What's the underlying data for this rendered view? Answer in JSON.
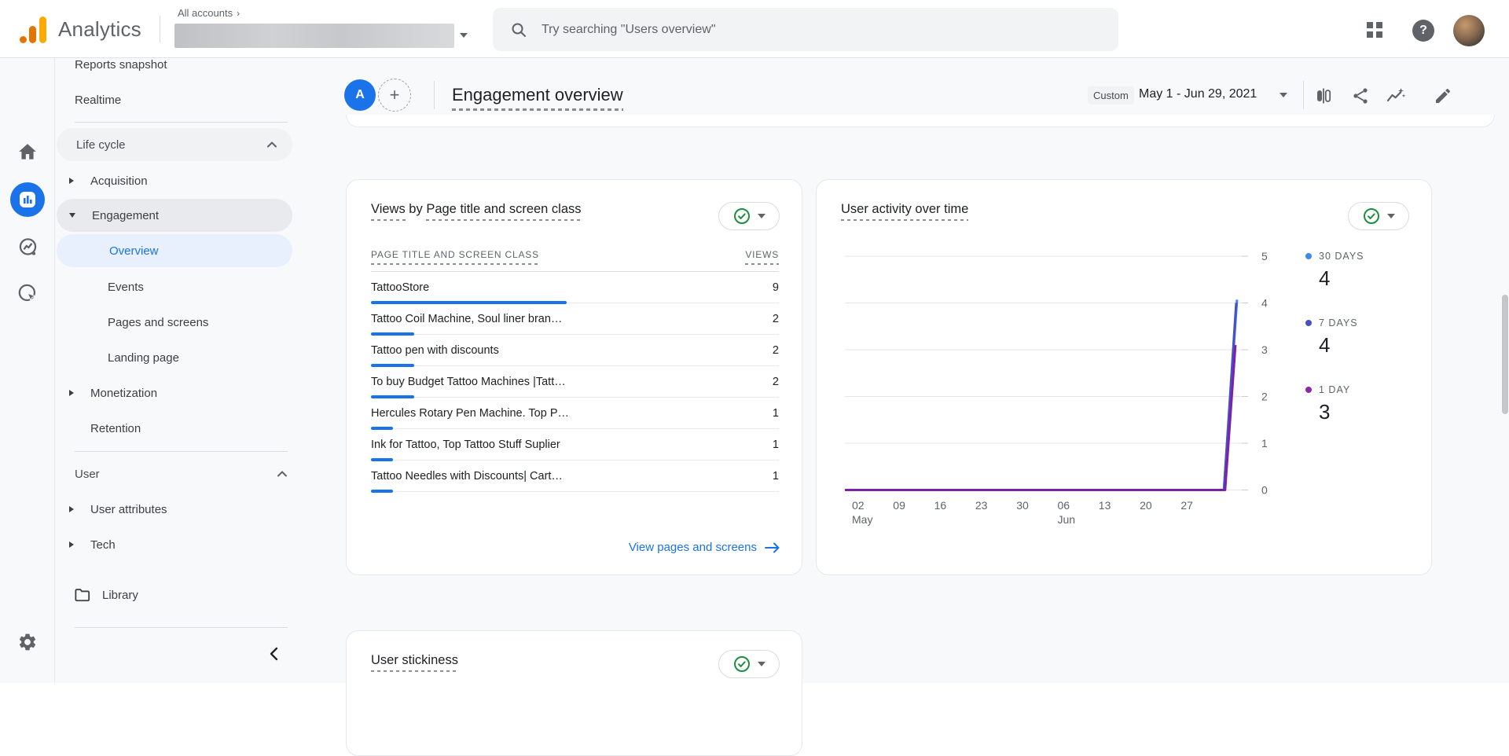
{
  "app_bar": {
    "product_name": "Analytics",
    "breadcrumb_all_accounts": "All accounts",
    "breadcrumb_separator": "›",
    "search_placeholder": "Try searching \"Users overview\"",
    "icons": {
      "search": "magnifier",
      "apps_grid": "2x2-squares",
      "help": "question-mark-circle",
      "account_caret": "caret-down"
    },
    "help_glyph": "?"
  },
  "rail_icons": [
    "home",
    "reports (active)",
    "explore",
    "advertising",
    "settings-gear"
  ],
  "sidebar": {
    "items": [
      {
        "label": "Reports snapshot"
      },
      {
        "label": "Realtime"
      },
      {
        "label": "Life cycle"
      },
      {
        "label": "Acquisition"
      },
      {
        "label": "Engagement"
      },
      {
        "label": "Overview"
      },
      {
        "label": "Events"
      },
      {
        "label": "Pages and screens"
      },
      {
        "label": "Landing page"
      },
      {
        "label": "Monetization"
      },
      {
        "label": "Retention"
      },
      {
        "label": "User"
      },
      {
        "label": "User attributes"
      },
      {
        "label": "Tech"
      },
      {
        "label": "Library"
      }
    ]
  },
  "report_header": {
    "avatar_letter": "A",
    "add_button": "+",
    "title": "Engagement overview",
    "date_badge": "Custom",
    "date_range": "May 1 - Jun 29, 2021",
    "icons": [
      "comparison-bars",
      "share",
      "insights-sparkline",
      "edit-pencil"
    ]
  },
  "cards": {
    "views_card": {
      "title_metric": "Views",
      "title_joiner": " by ",
      "title_dimension": "Page title and screen class",
      "status_icon": "green-check-circle",
      "table": {
        "col_dimension": "PAGE TITLE AND SCREEN CLASS",
        "col_metric": "VIEWS",
        "rows": [
          {
            "label": "TattooStore",
            "value": 9
          },
          {
            "label": "Tattoo Coil Machine, Soul liner bran…",
            "value": 2
          },
          {
            "label": "Tattoo pen with discounts",
            "value": 2
          },
          {
            "label": "To buy Budget Tattoo Machines |Tatt…",
            "value": 2
          },
          {
            "label": "Hercules Rotary Pen Machine. Top P…",
            "value": 1
          },
          {
            "label": "Ink for Tattoo, Top Tattoo Stuff Suplier",
            "value": 1
          },
          {
            "label": "Tattoo Needles with Discounts| Cart…",
            "value": 1
          }
        ],
        "bar_color": "#1a73e8"
      },
      "footer_link": "View pages and screens"
    },
    "activity_card": {
      "title": "User activity over time",
      "status_icon": "green-check-circle",
      "legend": [
        {
          "label": "30 DAYS",
          "value": "4",
          "color": "#4285f4"
        },
        {
          "label": "7 DAYS",
          "value": "4",
          "color": "#4750c8"
        },
        {
          "label": "1 DAY",
          "value": "3",
          "color": "#8d28ad"
        }
      ],
      "chart_data": {
        "type": "line",
        "title": "User activity over time",
        "ylim": [
          0,
          5
        ],
        "y_ticks": [
          5,
          4,
          3,
          2,
          1,
          0
        ],
        "x_ticks": [
          {
            "day": "02",
            "month": "May"
          },
          {
            "day": "09"
          },
          {
            "day": "16"
          },
          {
            "day": "23"
          },
          {
            "day": "30"
          },
          {
            "day": "06",
            "month": "Jun"
          },
          {
            "day": "13"
          },
          {
            "day": "20"
          },
          {
            "day": "27"
          }
        ],
        "grid": true,
        "legend_position": "right",
        "series": [
          {
            "name": "30 DAYS",
            "color": "#4285f4",
            "points": [
              [
                0,
                0
              ],
              [
                0.955,
                0
              ],
              [
                0.988,
                4.07
              ]
            ]
          },
          {
            "name": "7 DAYS",
            "color": "#4750c8",
            "points": [
              [
                0,
                0
              ],
              [
                0.955,
                0
              ],
              [
                0.986,
                4.0
              ]
            ]
          },
          {
            "name": "1 DAY",
            "color": "#7d22a8",
            "points": [
              [
                0,
                0
              ],
              [
                0.958,
                0
              ],
              [
                0.984,
                3.1
              ]
            ]
          }
        ]
      }
    },
    "stickiness_card": {
      "title": "User stickiness",
      "status_icon": "green-check-circle"
    }
  },
  "misc": {
    "collapse_chevron": "chevron-left",
    "scrollbar": "vertical-thumb"
  }
}
